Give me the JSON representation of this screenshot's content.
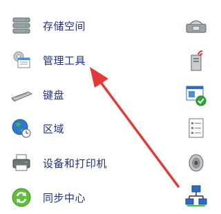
{
  "items": [
    {
      "label": "存储空间",
      "icon": "storage-drives-icon"
    },
    {
      "label": "管理工具",
      "icon": "admin-tools-icon"
    },
    {
      "label": "键盘",
      "icon": "keyboard-icon"
    },
    {
      "label": "区域",
      "icon": "globe-clock-icon"
    },
    {
      "label": "设备和打印机",
      "icon": "printer-icon"
    },
    {
      "label": "同步中心",
      "icon": "sync-icon"
    }
  ],
  "right_icons": [
    "telephone-modem-icon",
    "wireless-tower-icon",
    "security-check-window-icon",
    "task-list-icon",
    "speaker-icon",
    "network-icon"
  ],
  "annotation": {
    "color": "#e53935"
  }
}
